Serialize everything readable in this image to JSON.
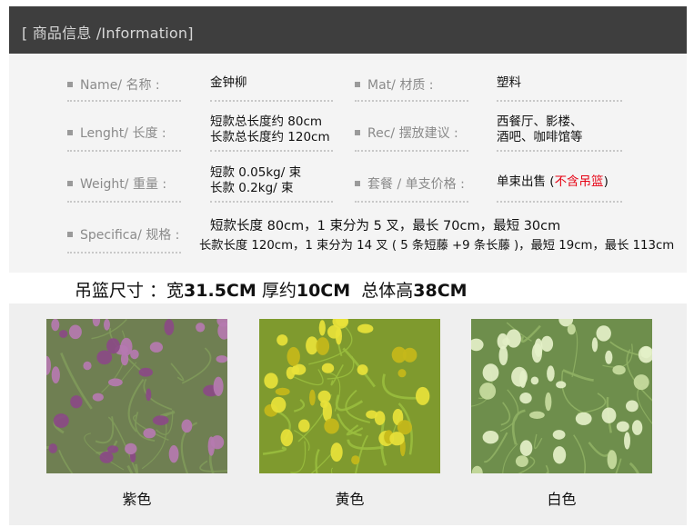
{
  "header": {
    "title": "[ 商品信息 /Information]"
  },
  "specs": {
    "name_label": "Name/ 名称 :",
    "name_value": "金钟柳",
    "mat_label": "Mat/ 材质 :",
    "mat_value": "塑料",
    "length_label": "Lenght/ 长度 :",
    "length_value_1": "短款总长度约 80cm",
    "length_value_2": "长款总长度约 120cm",
    "rec_label": "Rec/ 摆放建议 :",
    "rec_value_1": "西餐厅、影楼、",
    "rec_value_2": "酒吧、咖啡馆等",
    "weight_label": "Weight/ 重量 :",
    "weight_value_1": "短款 0.05kg/ 束",
    "weight_value_2": "长款 0.2kg/ 束",
    "package_label": "套餐 / 单支价格 :",
    "package_value": "单束出售 (",
    "package_note": "不含吊篮",
    "package_close": ")",
    "specifica_label": "Specifica/ 规格 :",
    "specifica_value_1": "短款长度 80cm，1 束分为 5 叉，最长 70cm，最短 30cm",
    "specifica_value_2": "长款长度 120cm，1 束分为 14 叉 ( 5 条短藤 +9 条长藤 )，最短 19cm，最长 113cm"
  },
  "basket": {
    "prefix": "吊篮尺寸 ：宽",
    "width": "31.5CM",
    "thick_label": "厚约",
    "thick": "10CM",
    "height_label": "总体高",
    "height": "38CM"
  },
  "colors": [
    {
      "caption": "紫色",
      "flower": "#b57ab0",
      "accent": "#8a4a86",
      "leaf": "#7f9a5a",
      "bg": "#6f7f52"
    },
    {
      "caption": "黄色",
      "flower": "#e8e23a",
      "accent": "#c6b81a",
      "leaf": "#9abe3e",
      "bg": "#7f9a2e"
    },
    {
      "caption": "白色",
      "flower": "#e4f0c8",
      "accent": "#c8dca0",
      "leaf": "#8fb064",
      "bg": "#6e8e4c"
    }
  ]
}
